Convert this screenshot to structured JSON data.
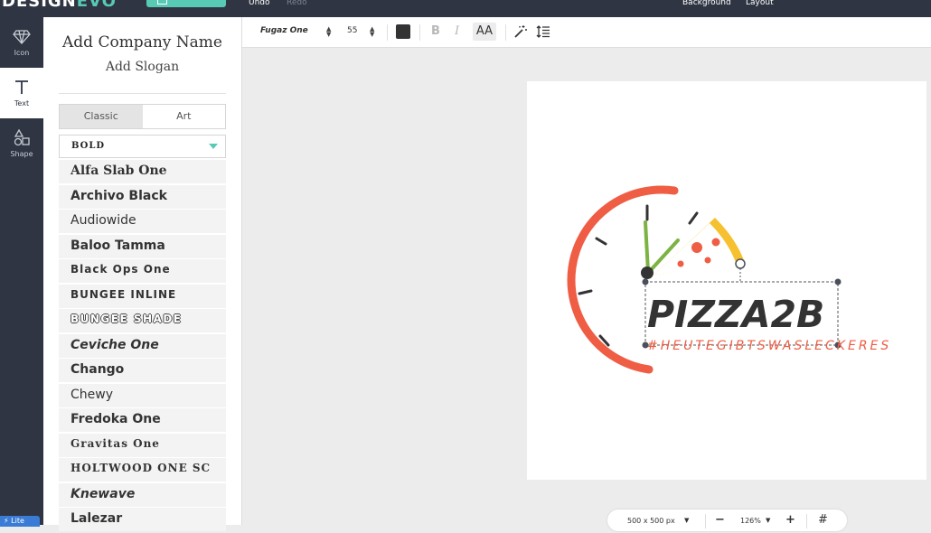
{
  "app": {
    "logo_main": "DESIGN",
    "logo_accent": "EVO"
  },
  "topbar": {
    "undo_label": "Undo",
    "redo_label": "Redo",
    "background_label": "Background",
    "layout_label": "Layout"
  },
  "rail": {
    "items": [
      {
        "label": "Icon",
        "icon": "diamond-icon"
      },
      {
        "label": "Text",
        "icon": "text-t-icon"
      },
      {
        "label": "Shape",
        "icon": "shapes-icon"
      }
    ],
    "badge": "⚡ Lite"
  },
  "panel": {
    "company_name": "Add Company Name",
    "slogan": "Add Slogan",
    "tabs": [
      "Classic",
      "Art"
    ],
    "active_tab": "Classic",
    "category": "BOLD",
    "fonts": [
      "Alfa Slab One",
      "Archivo Black",
      "Audiowide",
      "Baloo Tamma",
      "Black Ops One",
      "BUNGEE INLINE",
      "BUNGEE SHADE",
      "Ceviche One",
      "Chango",
      "Chewy",
      "Fredoka One",
      "Gravitas One",
      "HOLTWOOD ONE SC",
      "Knewave",
      "Lalezar"
    ]
  },
  "toolbar": {
    "font_family": "Fugaz One",
    "font_size": "55",
    "text_color": "#333333",
    "bold_label": "B",
    "italic_label": "I",
    "case_label": "AA"
  },
  "logo": {
    "name": "PIZZA2B",
    "tagline": "#HEUTEGIBTSWASLECKERES",
    "colors": {
      "ring": "#ee5d44",
      "slice": "#f6c02e",
      "hand": "#7cb342",
      "text": "#333333"
    }
  },
  "bottombar": {
    "size": "500 x 500 px",
    "zoom": "126%",
    "minus": "−",
    "plus": "+"
  }
}
